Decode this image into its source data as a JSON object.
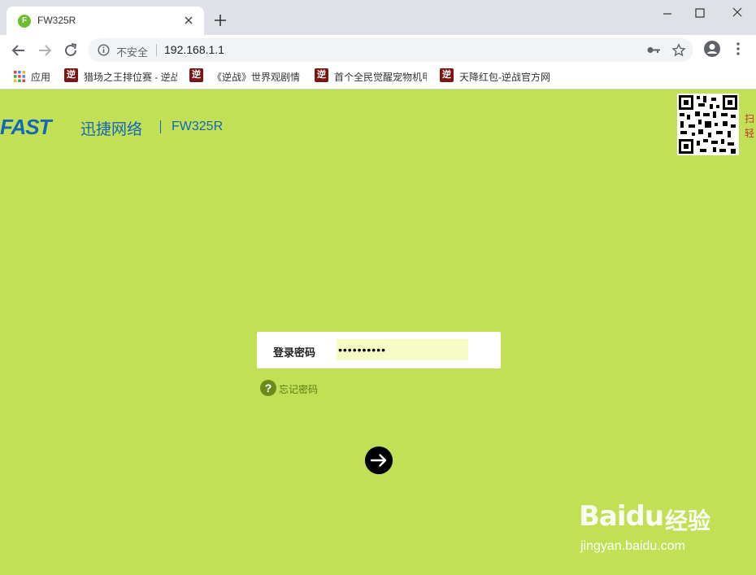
{
  "browser": {
    "tab_title": "FW325R",
    "favicon_letter": "F",
    "security_label": "不安全",
    "url": "192.168.1.1",
    "icons": [
      "tab-close-icon",
      "new-tab-icon",
      "minimize-icon",
      "maximize-icon",
      "window-close-icon",
      "back-icon",
      "forward-icon",
      "reload-icon",
      "info-icon",
      "key-icon",
      "star-icon",
      "profile-icon",
      "menu-icon",
      "apps-icon"
    ]
  },
  "bookmarks": {
    "apps_label": "应用",
    "fav_glyph": "逆",
    "items": [
      {
        "label": "猎场之王排位赛 - 逆战"
      },
      {
        "label": "《逆战》世界观剧情"
      },
      {
        "label": "首个全民觉醒宠物机甲"
      },
      {
        "label": "天降红包-逆战官方网"
      }
    ]
  },
  "page": {
    "logo": "FAST",
    "brand_cn": "迅捷网络",
    "model": "FW325R",
    "qr_text": "扫轻",
    "login": {
      "label": "登录密码",
      "password_value": "••••••••••"
    },
    "forgot_label": "忘记密码",
    "accent_color": "#c2e055",
    "brand_color": "#1466b8"
  },
  "watermark": {
    "text": "Baidu",
    "cn": "经验",
    "url": "jingyan.baidu.com"
  }
}
